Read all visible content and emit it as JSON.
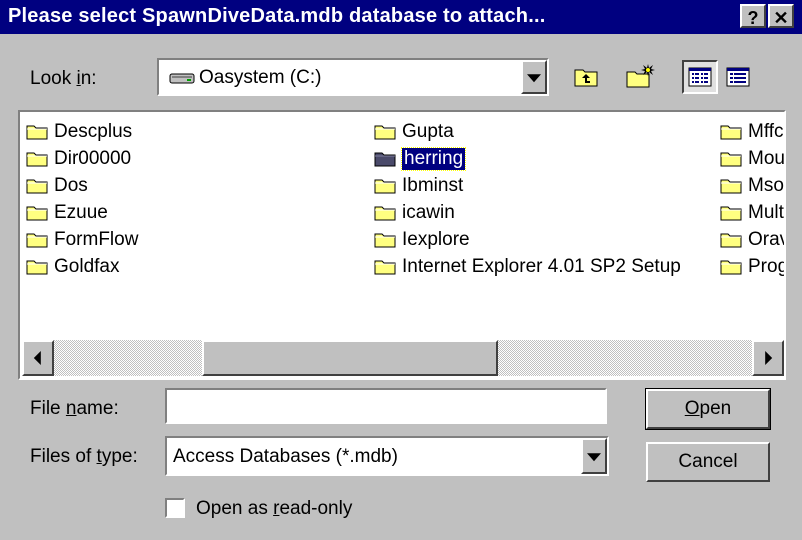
{
  "window": {
    "title": "Please select SpawnDiveData.mdb database to attach...",
    "help_button": "?",
    "close_button": "✕"
  },
  "look_in": {
    "label_pre": "Look ",
    "label_accel": "i",
    "label_post": "n:",
    "value": "Oasystem (C:)"
  },
  "files": {
    "columns": [
      [
        "Descplus",
        "Dir00000",
        "Dos",
        "Ezuue",
        "FormFlow",
        "Goldfax"
      ],
      [
        "Gupta",
        "herring",
        "Ibminst",
        "icawin",
        "Iexplore",
        "Internet Explorer 4.01 SP2 Setup"
      ],
      [
        "Mffc",
        "Mou",
        "Mso",
        "Mult",
        "Orav",
        "Prog"
      ]
    ],
    "selected": "herring"
  },
  "file_name": {
    "label_pre": "File ",
    "label_accel": "n",
    "label_post": "ame:",
    "value": ""
  },
  "files_of_type": {
    "label_pre": "Files of ",
    "label_accel": "t",
    "label_post": "ype:",
    "value": "Access Databases (*.mdb)"
  },
  "buttons": {
    "open_accel": "O",
    "open_rest": "pen",
    "cancel": "Cancel"
  },
  "readonly": {
    "label_pre": "Open as ",
    "label_accel": "r",
    "label_post": "ead-only",
    "checked": false
  },
  "colors": {
    "titlebar": "#000080",
    "dialog": "#c0c0c0",
    "folder": "#ffff80",
    "selection": "#000080"
  }
}
